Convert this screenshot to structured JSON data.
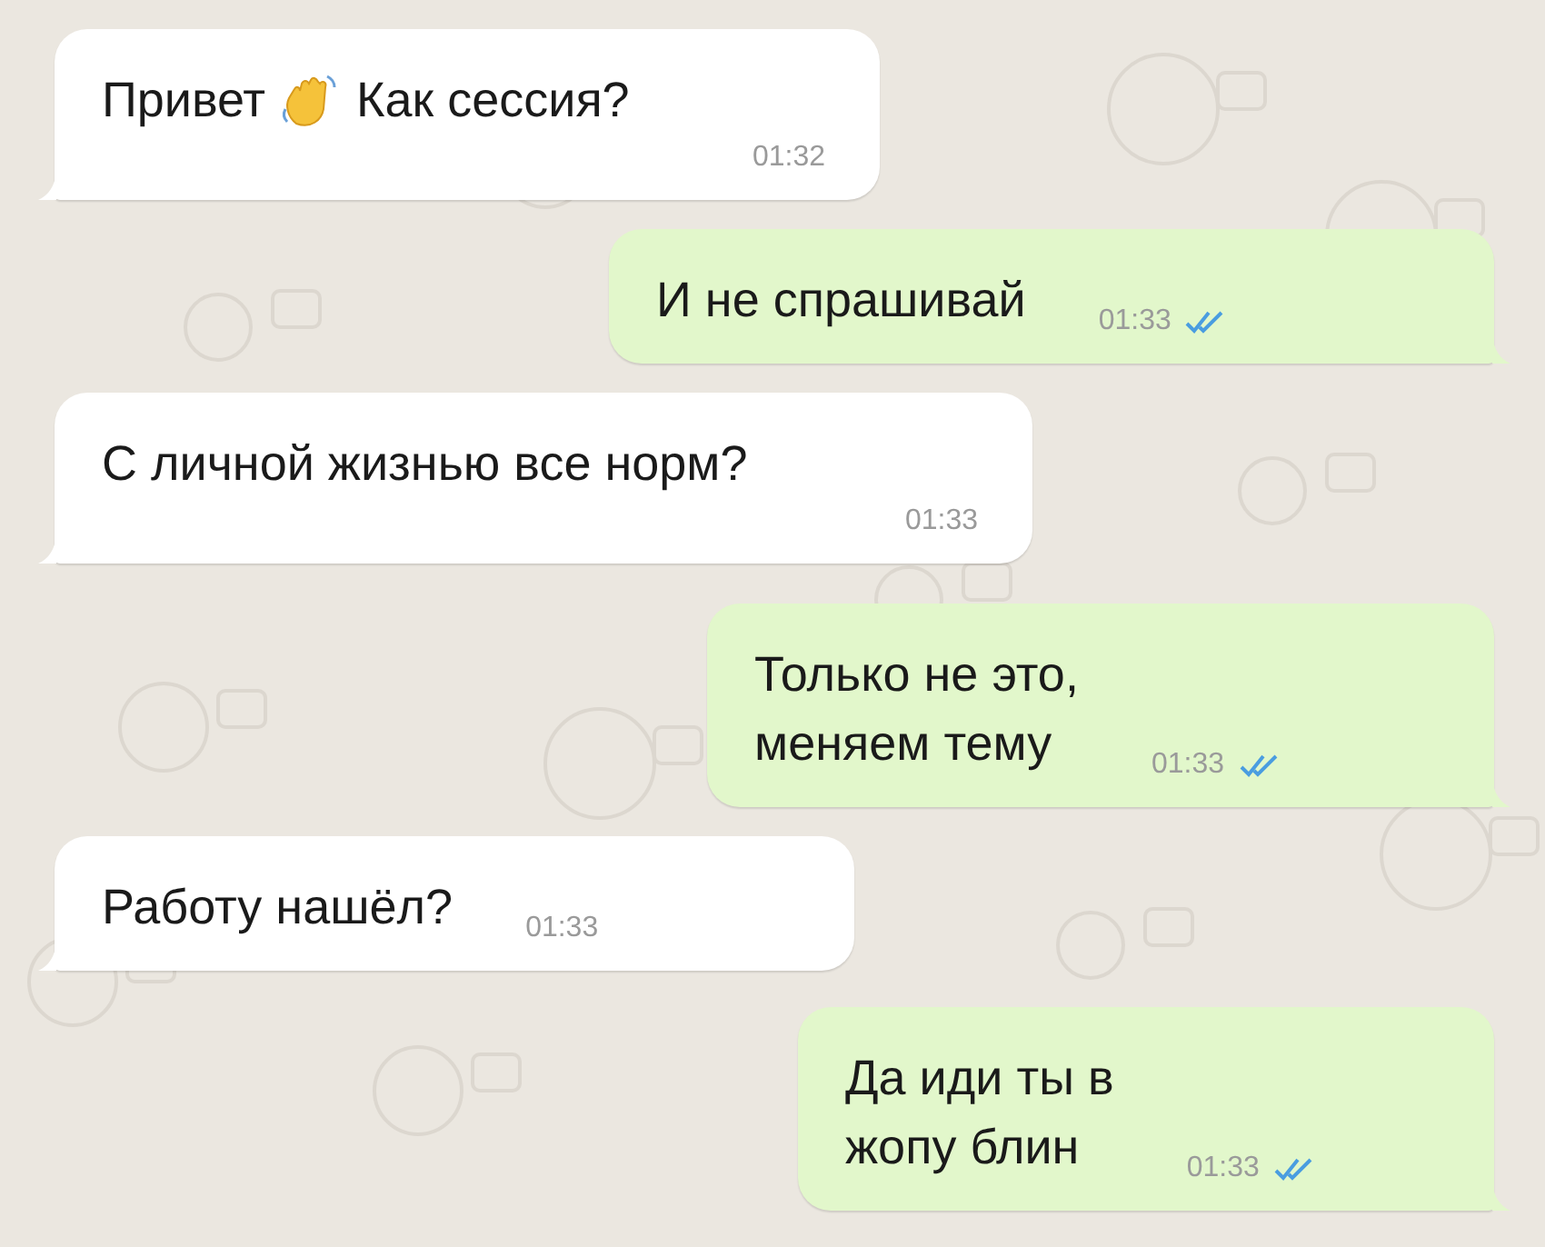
{
  "messages": [
    {
      "kind": "incoming",
      "text": "Привет",
      "emoji_text": "Как сессия?",
      "time": "01:32"
    },
    {
      "kind": "outgoing",
      "text": "И не спрашивай",
      "time": "01:33",
      "read": true
    },
    {
      "kind": "incoming",
      "text": "С личной жизнью все норм?",
      "time": "01:33"
    },
    {
      "kind": "outgoing",
      "text": "Только не это,\nменяем тему",
      "time": "01:33",
      "read": true
    },
    {
      "kind": "incoming",
      "text": "Работу нашёл?",
      "time": "01:33"
    },
    {
      "kind": "outgoing",
      "text": "Да иди ты в\nжопу блин",
      "time": "01:33",
      "read": true
    }
  ]
}
